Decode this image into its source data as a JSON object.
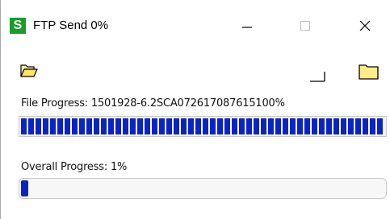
{
  "window": {
    "title": "FTP Send 0%",
    "app_icon_letter": "S",
    "app_icon_color": "#1a9c2a"
  },
  "toolbar": {
    "left_icon": "open-folder-icon",
    "middle_icon": "corner-bracket-icon",
    "right_icon": "folder-icon"
  },
  "file_progress": {
    "label": "File Progress: 1501928-6.2SCA072617087615100%",
    "percent": 100,
    "fill_color": "#0a24c4"
  },
  "overall_progress": {
    "label": "Overall Progress: 1%",
    "percent": 1,
    "fill_color": "#0a24c4"
  }
}
